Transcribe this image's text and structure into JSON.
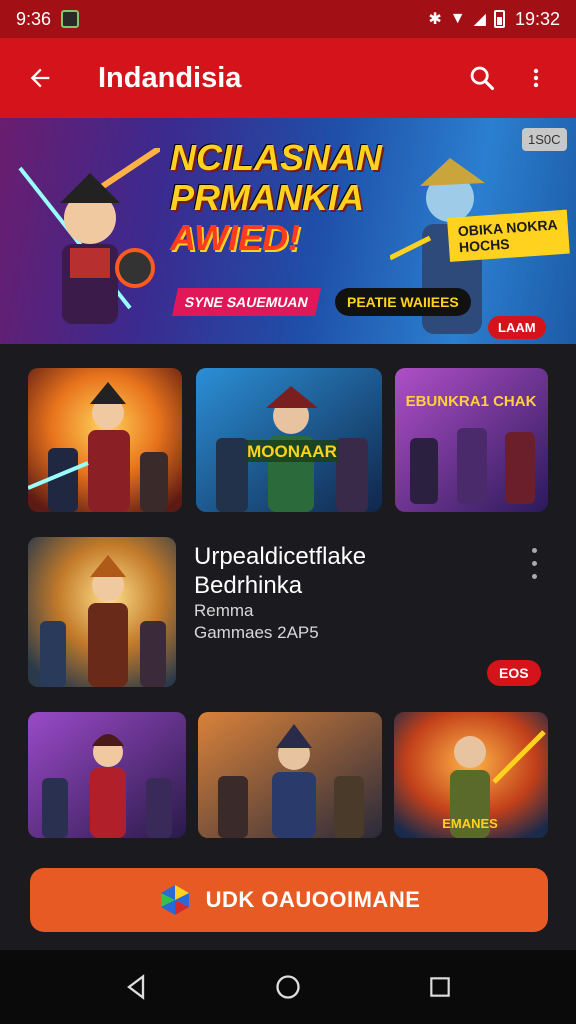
{
  "status_bar": {
    "time_left": "9:36",
    "time_right": "19:32"
  },
  "app_bar": {
    "title": "Indandisia"
  },
  "banner": {
    "headline_line1": "NCILASNAN",
    "headline_line2": "PRMANKIA",
    "headline_line3": "AWIED!",
    "sticker": "OBIKA NOKRA\nHOCHS",
    "pill_left": "SYNE SAUEMUAN",
    "pill_right": "PEATIE WAIIEES",
    "tag_top": "1S0C",
    "tag_bottom": "LAAM"
  },
  "thumb_row1": [
    {
      "badge": ""
    },
    {
      "badge": "",
      "art_text": "MOONAAR"
    },
    {
      "art_text": "EBUNKRA1 CHAK"
    }
  ],
  "featured": {
    "title_line1": "Urpealdicetflake",
    "title_line2": "Bedrhinka",
    "subtitle_line1": "Remma",
    "subtitle_line2": "Gammaes 2AP5",
    "badge": "EOS"
  },
  "thumb_row2": [
    {
      "art_text": ""
    },
    {
      "art_text": ""
    },
    {
      "art_text": "EMANES"
    }
  ],
  "cta": {
    "label": "UDK OAUOOIMANE"
  },
  "colors": {
    "accent_red": "#d4141a",
    "cta_orange": "#e85a23",
    "background": "#1b1b1f"
  }
}
